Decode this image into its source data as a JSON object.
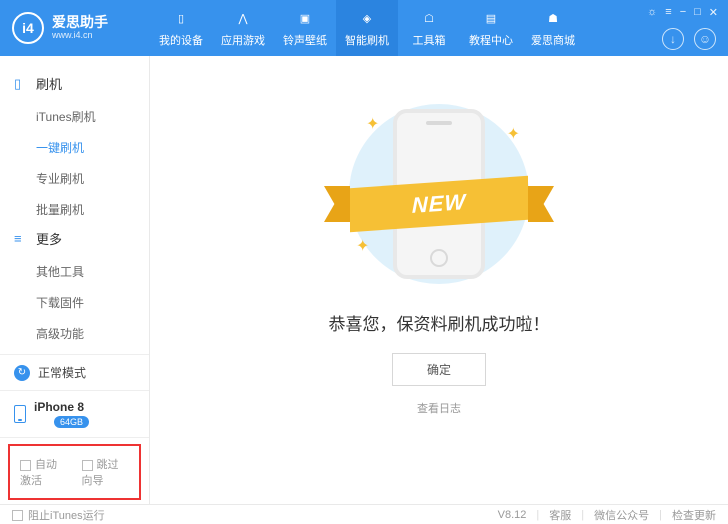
{
  "brand": {
    "name": "爱思助手",
    "url": "www.i4.cn"
  },
  "tabs": [
    {
      "label": "我的设备"
    },
    {
      "label": "应用游戏"
    },
    {
      "label": "铃声壁纸"
    },
    {
      "label": "智能刷机"
    },
    {
      "label": "工具箱"
    },
    {
      "label": "教程中心"
    },
    {
      "label": "爱思商城"
    }
  ],
  "sidebar": {
    "section1_title": "刷机",
    "section1_items": [
      "iTunes刷机",
      "一键刷机",
      "专业刷机",
      "批量刷机"
    ],
    "section2_title": "更多",
    "section2_items": [
      "其他工具",
      "下载固件",
      "高级功能"
    ]
  },
  "status": {
    "mode": "正常模式",
    "device": "iPhone 8",
    "storage": "64GB"
  },
  "checks": {
    "auto_activate": "自动激活",
    "skip_guide": "跳过向导"
  },
  "illus": {
    "ribbon": "NEW"
  },
  "main": {
    "message": "恭喜您，保资料刷机成功啦！",
    "ok": "确定",
    "log": "查看日志"
  },
  "footer": {
    "block_itunes": "阻止iTunes运行",
    "version": "V8.12",
    "support": "客服",
    "wechat": "微信公众号",
    "update": "检查更新"
  }
}
